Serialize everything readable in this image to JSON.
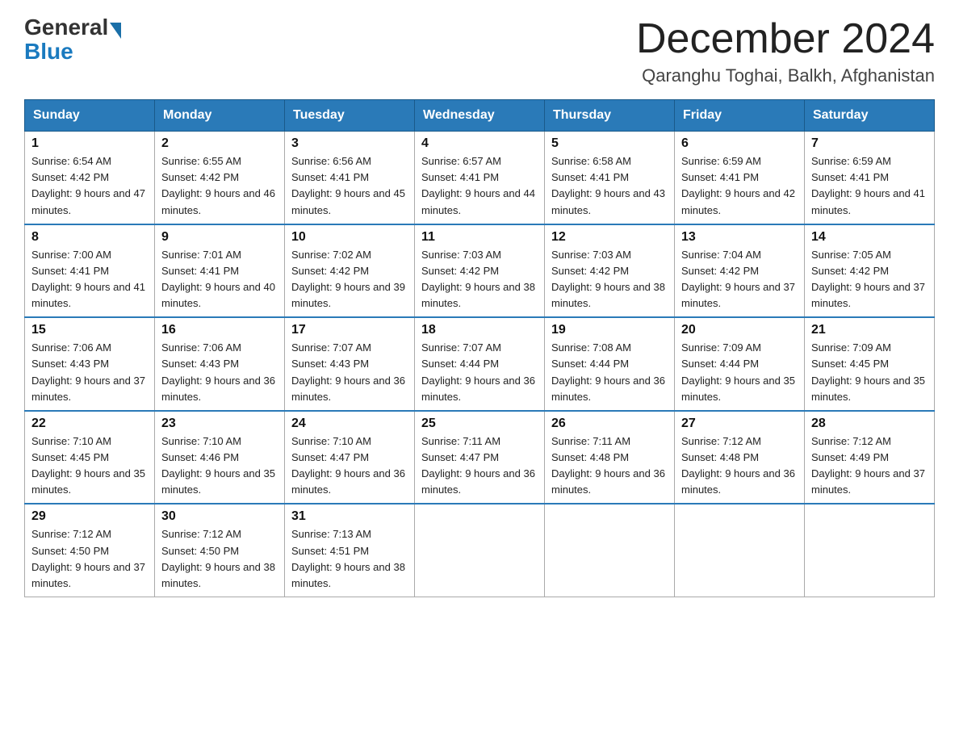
{
  "header": {
    "logo_general": "General",
    "logo_blue": "Blue",
    "month_title": "December 2024",
    "location": "Qaranghu Toghai, Balkh, Afghanistan"
  },
  "weekdays": [
    "Sunday",
    "Monday",
    "Tuesday",
    "Wednesday",
    "Thursday",
    "Friday",
    "Saturday"
  ],
  "weeks": [
    [
      {
        "day": 1,
        "sunrise": "6:54 AM",
        "sunset": "4:42 PM",
        "daylight": "9 hours and 47 minutes"
      },
      {
        "day": 2,
        "sunrise": "6:55 AM",
        "sunset": "4:42 PM",
        "daylight": "9 hours and 46 minutes"
      },
      {
        "day": 3,
        "sunrise": "6:56 AM",
        "sunset": "4:41 PM",
        "daylight": "9 hours and 45 minutes"
      },
      {
        "day": 4,
        "sunrise": "6:57 AM",
        "sunset": "4:41 PM",
        "daylight": "9 hours and 44 minutes"
      },
      {
        "day": 5,
        "sunrise": "6:58 AM",
        "sunset": "4:41 PM",
        "daylight": "9 hours and 43 minutes"
      },
      {
        "day": 6,
        "sunrise": "6:59 AM",
        "sunset": "4:41 PM",
        "daylight": "9 hours and 42 minutes"
      },
      {
        "day": 7,
        "sunrise": "6:59 AM",
        "sunset": "4:41 PM",
        "daylight": "9 hours and 41 minutes"
      }
    ],
    [
      {
        "day": 8,
        "sunrise": "7:00 AM",
        "sunset": "4:41 PM",
        "daylight": "9 hours and 41 minutes"
      },
      {
        "day": 9,
        "sunrise": "7:01 AM",
        "sunset": "4:41 PM",
        "daylight": "9 hours and 40 minutes"
      },
      {
        "day": 10,
        "sunrise": "7:02 AM",
        "sunset": "4:42 PM",
        "daylight": "9 hours and 39 minutes"
      },
      {
        "day": 11,
        "sunrise": "7:03 AM",
        "sunset": "4:42 PM",
        "daylight": "9 hours and 38 minutes"
      },
      {
        "day": 12,
        "sunrise": "7:03 AM",
        "sunset": "4:42 PM",
        "daylight": "9 hours and 38 minutes"
      },
      {
        "day": 13,
        "sunrise": "7:04 AM",
        "sunset": "4:42 PM",
        "daylight": "9 hours and 37 minutes"
      },
      {
        "day": 14,
        "sunrise": "7:05 AM",
        "sunset": "4:42 PM",
        "daylight": "9 hours and 37 minutes"
      }
    ],
    [
      {
        "day": 15,
        "sunrise": "7:06 AM",
        "sunset": "4:43 PM",
        "daylight": "9 hours and 37 minutes"
      },
      {
        "day": 16,
        "sunrise": "7:06 AM",
        "sunset": "4:43 PM",
        "daylight": "9 hours and 36 minutes"
      },
      {
        "day": 17,
        "sunrise": "7:07 AM",
        "sunset": "4:43 PM",
        "daylight": "9 hours and 36 minutes"
      },
      {
        "day": 18,
        "sunrise": "7:07 AM",
        "sunset": "4:44 PM",
        "daylight": "9 hours and 36 minutes"
      },
      {
        "day": 19,
        "sunrise": "7:08 AM",
        "sunset": "4:44 PM",
        "daylight": "9 hours and 36 minutes"
      },
      {
        "day": 20,
        "sunrise": "7:09 AM",
        "sunset": "4:44 PM",
        "daylight": "9 hours and 35 minutes"
      },
      {
        "day": 21,
        "sunrise": "7:09 AM",
        "sunset": "4:45 PM",
        "daylight": "9 hours and 35 minutes"
      }
    ],
    [
      {
        "day": 22,
        "sunrise": "7:10 AM",
        "sunset": "4:45 PM",
        "daylight": "9 hours and 35 minutes"
      },
      {
        "day": 23,
        "sunrise": "7:10 AM",
        "sunset": "4:46 PM",
        "daylight": "9 hours and 35 minutes"
      },
      {
        "day": 24,
        "sunrise": "7:10 AM",
        "sunset": "4:47 PM",
        "daylight": "9 hours and 36 minutes"
      },
      {
        "day": 25,
        "sunrise": "7:11 AM",
        "sunset": "4:47 PM",
        "daylight": "9 hours and 36 minutes"
      },
      {
        "day": 26,
        "sunrise": "7:11 AM",
        "sunset": "4:48 PM",
        "daylight": "9 hours and 36 minutes"
      },
      {
        "day": 27,
        "sunrise": "7:12 AM",
        "sunset": "4:48 PM",
        "daylight": "9 hours and 36 minutes"
      },
      {
        "day": 28,
        "sunrise": "7:12 AM",
        "sunset": "4:49 PM",
        "daylight": "9 hours and 37 minutes"
      }
    ],
    [
      {
        "day": 29,
        "sunrise": "7:12 AM",
        "sunset": "4:50 PM",
        "daylight": "9 hours and 37 minutes"
      },
      {
        "day": 30,
        "sunrise": "7:12 AM",
        "sunset": "4:50 PM",
        "daylight": "9 hours and 38 minutes"
      },
      {
        "day": 31,
        "sunrise": "7:13 AM",
        "sunset": "4:51 PM",
        "daylight": "9 hours and 38 minutes"
      },
      null,
      null,
      null,
      null
    ]
  ]
}
